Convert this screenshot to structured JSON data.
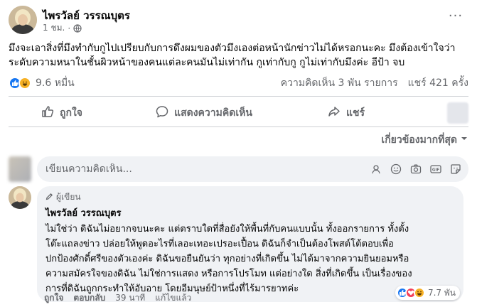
{
  "post": {
    "author": "ไพรวัลย์ วรรณบุตร",
    "time": "1 ชม.",
    "time_separator": "·",
    "text_lines": [
      "มึงจะเอาสิ่งที่มึงทำกับกูไปเปรียบกับการดึงผมของตัวมึงเองต่อหน้านักข่าวไม่ได้หรอกนะคะ มึงต้องเข้าใจว่า",
      "ระดับความหนาในชั้นผิวหน้าของคนแต่ละคนมันไม่เท่ากัน กูเท่ากับกู กูไม่เท่ากับมึงค่ะ อีป้า จบ"
    ],
    "reactions": {
      "count": "9.6 หมื่น",
      "types": [
        "like",
        "haha"
      ]
    },
    "comments_count": "ความคิดเห็น 3 พัน รายการ",
    "shares_count": "แชร์ 421 ครั้ง"
  },
  "actions": {
    "like": "ถูกใจ",
    "comment": "แสดงความคิดเห็น",
    "share": "แชร์"
  },
  "sort": {
    "label": "เกี่ยวข้องมากที่สุด"
  },
  "composer": {
    "placeholder": "เขียนความคิดเห็น..."
  },
  "comment": {
    "badge": "ผู้เขียน",
    "author": "ไพรวัลย์ วรรณบุตร",
    "text_lines": [
      "ไม่ใช่ว่า ดิฉันไม่อยากจบนะคะ แต่ตราบใดที่สื่อยังให้พื้นที่กับคนแบบนั้น ทั้งออกรายการ ทั้งตั้ง",
      "โต๊ะแถลงข่าว ปล่อยให้พูดอะไรที่เลอะเทอะเปรอะเปื้อน ดิฉันก็จำเป็นต้องโพสต์โต้ตอบเพื่อ",
      "ปกป้องศักดิ์ศรีของตัวเองค่ะ ดิฉันขอยืนยันว่า ทุกอย่างที่เกิดขึ้น ไม่ได้มาจากความยินยอมหรือ",
      "ความสมัครใจของดิฉัน ไม่ใช่การแสดง หรือการโปรโมท แต่อย่างใด สิ่งที่เกิดขึ้น เป็นเรื่องของ",
      "การที่ดิฉันถูกกระทำให้อับอาย โดยอีมนุษย์ป้าหนึ่งที่ไร้มารยาทค่ะ"
    ],
    "like_label": "ถูกใจ",
    "reply_label": "ตอบกลับ",
    "time": "39 นาที",
    "edited": "แก้ไขแล้ว",
    "reaction_count": "7.7 พัน",
    "reaction_types": [
      "like",
      "love",
      "haha"
    ]
  },
  "colors": {
    "like_blue": "#1877f2",
    "love_red": "#f33e58",
    "haha_yellow": "#f7b125",
    "secondary_text": "#65676b",
    "bubble_bg": "#f0f2f5"
  }
}
